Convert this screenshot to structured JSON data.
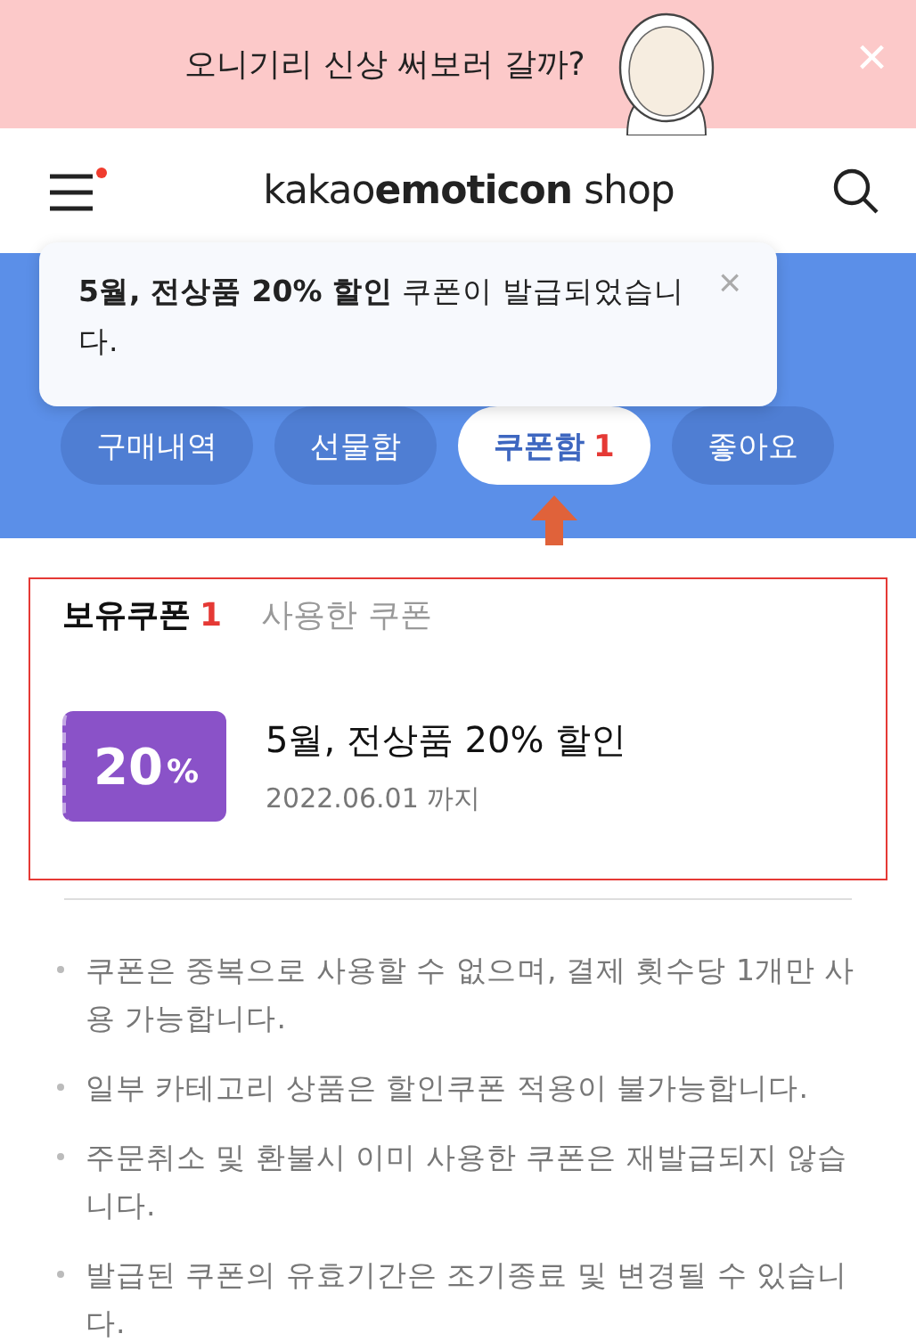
{
  "promo_banner": {
    "text": "오니기리 신상 써보러 갈까?",
    "close": "×"
  },
  "header": {
    "logo_light": "kakao",
    "logo_bold": "emoticon",
    "logo_tail": " shop",
    "menu_badge": true
  },
  "toast": {
    "message": "**5월, 전상품 20% 할인** 쿠폰이 발급되었습니다.",
    "close": "×"
  },
  "tabs": [
    {
      "label": "구매내역",
      "selected": false
    },
    {
      "label": "선물함",
      "selected": false
    },
    {
      "label": "쿠폰함",
      "count": "1",
      "selected": true
    },
    {
      "label": "좋아요",
      "selected": false
    }
  ],
  "coupon_tabs": [
    {
      "label": "보유쿠폰",
      "count": "1",
      "selected": true
    },
    {
      "label": "사용한 쿠폰",
      "selected": false
    }
  ],
  "coupons": [
    {
      "value": "20",
      "unit": "%",
      "color": "#8a52c8",
      "title": "5월, 전상품 20% 할인",
      "expiry": "2022.06.01 까지"
    }
  ],
  "notes": [
    "쿠폰은 중복으로 사용할 수 없으며, 결제 횟수당 1개만 사용 가능합니다.",
    "일부 카테고리 상품은 할인쿠폰 적용이 불가능합니다.",
    "주문취소 및 환불시 이미 사용한 쿠폰은 재발급되지 않습니다.",
    "발급된 쿠폰의 유효기간은 조기종료 및 변경될 수 있습니다."
  ]
}
